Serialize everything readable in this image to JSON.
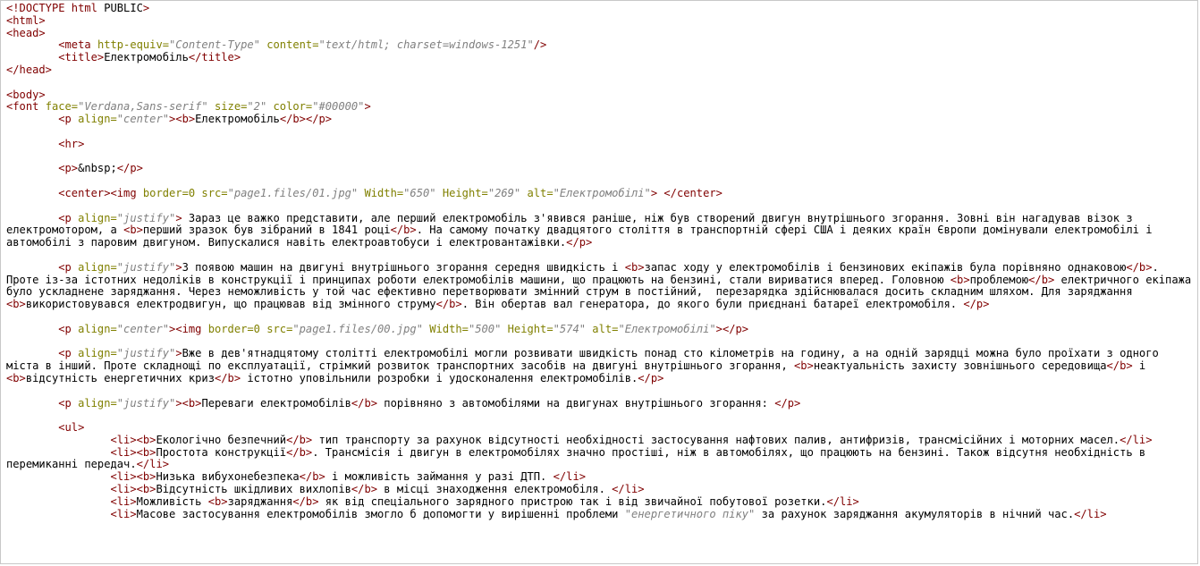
{
  "editor": {
    "colors": {
      "tag": "#800000",
      "attribute": "#808000",
      "string": "#808080",
      "text": "#000000",
      "border": "#c8c8c8"
    },
    "lines": [
      [
        [
          "tag",
          "<!DOCTYPE html"
        ],
        [
          "text",
          " PUBLIC"
        ],
        [
          "tag",
          ">"
        ]
      ],
      [
        [
          "tag",
          "<html>"
        ]
      ],
      [
        [
          "tag",
          "<head>"
        ]
      ],
      [
        [
          "text",
          "        "
        ],
        [
          "tag",
          "<meta "
        ],
        [
          "attr",
          "http-equiv="
        ],
        [
          "str",
          "\"Content-Type\""
        ],
        [
          "attr",
          " content="
        ],
        [
          "str",
          "\"text/html; charset=windows-1251\""
        ],
        [
          "tag",
          "/>"
        ]
      ],
      [
        [
          "text",
          "        "
        ],
        [
          "tag",
          "<title>"
        ],
        [
          "text",
          "Електромобіль"
        ],
        [
          "tag",
          "</title>"
        ]
      ],
      [
        [
          "tag",
          "</head>"
        ]
      ],
      [],
      [
        [
          "tag",
          "<body>"
        ]
      ],
      [
        [
          "tag",
          "<font "
        ],
        [
          "attr",
          "face="
        ],
        [
          "str",
          "\"Verdana,Sans-serif\""
        ],
        [
          "attr",
          " size="
        ],
        [
          "str",
          "\"2\""
        ],
        [
          "attr",
          " color="
        ],
        [
          "str",
          "\"#00000\""
        ],
        [
          "tag",
          ">"
        ]
      ],
      [
        [
          "text",
          "        "
        ],
        [
          "tag",
          "<p "
        ],
        [
          "attr",
          "align="
        ],
        [
          "str",
          "\"center\""
        ],
        [
          "tag",
          ">"
        ],
        [
          "tag",
          "<b>"
        ],
        [
          "text",
          "Електромобіль"
        ],
        [
          "tag",
          "</b>"
        ],
        [
          "tag",
          "</p>"
        ]
      ],
      [],
      [
        [
          "text",
          "        "
        ],
        [
          "tag",
          "<hr>"
        ]
      ],
      [],
      [
        [
          "text",
          "        "
        ],
        [
          "tag",
          "<p>"
        ],
        [
          "text",
          "&nbsp;"
        ],
        [
          "tag",
          "</p>"
        ]
      ],
      [],
      [
        [
          "text",
          "        "
        ],
        [
          "tag",
          "<center>"
        ],
        [
          "tag",
          "<img "
        ],
        [
          "attr",
          "border=0 src="
        ],
        [
          "str",
          "\"page1.files/01.jpg\""
        ],
        [
          "attr",
          " Width="
        ],
        [
          "str",
          "\"650\""
        ],
        [
          "attr",
          " Height="
        ],
        [
          "str",
          "\"269\""
        ],
        [
          "attr",
          " alt="
        ],
        [
          "str",
          "\"Електромобілі\""
        ],
        [
          "tag",
          ">"
        ],
        [
          "text",
          " "
        ],
        [
          "tag",
          "</center>"
        ]
      ],
      [],
      [
        [
          "text",
          "        "
        ],
        [
          "tag",
          "<p "
        ],
        [
          "attr",
          "align="
        ],
        [
          "str",
          "\"justify\""
        ],
        [
          "tag",
          ">"
        ],
        [
          "text",
          " Зараз це важко представити, але перший електромобіль з'явився раніше, ніж був створений двигун внутрішнього згорання. Зовні він нагадував візок з електромотором, а "
        ],
        [
          "tag",
          "<b>"
        ],
        [
          "text",
          "перший зразок був зібраний в 1841 році"
        ],
        [
          "tag",
          "</b>"
        ],
        [
          "text",
          ". На самому початку двадцятого століття в транспортній сфері США і деяких країн Європи домінували електромобілі і автомобілі з паровим двигуном. Випускалися навіть електроавтобуси і електровантажівки."
        ],
        [
          "tag",
          "</p>"
        ]
      ],
      [],
      [
        [
          "text",
          "        "
        ],
        [
          "tag",
          "<p "
        ],
        [
          "attr",
          "align="
        ],
        [
          "str",
          "\"justify\""
        ],
        [
          "tag",
          ">"
        ],
        [
          "text",
          "З появою машин на двигуні внутрішнього згорання середня швидкість і "
        ],
        [
          "tag",
          "<b>"
        ],
        [
          "text",
          "запас ходу у електромобілів і бензинових екіпажів була порівняно однаковою"
        ],
        [
          "tag",
          "</b>"
        ],
        [
          "text",
          ". Проте із-за істотних недоліків в конструкції і принципах роботи електромобілів машини, що працюють на бензині, стали вириватися вперед. Головною "
        ],
        [
          "tag",
          "<b>"
        ],
        [
          "text",
          "проблемою"
        ],
        [
          "tag",
          "</b>"
        ],
        [
          "text",
          " електричного екіпажа було ускладнене заряджання. Через неможливість у той час ефективно перетворювати змінний струм в постійний,  перезарядка здійснювалася досить складним шляхом. Для заряджання "
        ],
        [
          "tag",
          "<b>"
        ],
        [
          "text",
          "використовувався електродвигун, що працював від змінного струму"
        ],
        [
          "tag",
          "</b>"
        ],
        [
          "text",
          ". Він обертав вал генератора, до якого були приєднані батареї електромобіля. "
        ],
        [
          "tag",
          "</p>"
        ]
      ],
      [],
      [
        [
          "text",
          "        "
        ],
        [
          "tag",
          "<p "
        ],
        [
          "attr",
          "align="
        ],
        [
          "str",
          "\"center\""
        ],
        [
          "tag",
          ">"
        ],
        [
          "tag",
          "<img "
        ],
        [
          "attr",
          "border=0 src="
        ],
        [
          "str",
          "\"page1.files/00.jpg\""
        ],
        [
          "attr",
          " Width="
        ],
        [
          "str",
          "\"500\""
        ],
        [
          "attr",
          " Height="
        ],
        [
          "str",
          "\"574\""
        ],
        [
          "attr",
          " alt="
        ],
        [
          "str",
          "\"Електромобілі\""
        ],
        [
          "tag",
          ">"
        ],
        [
          "tag",
          "</p>"
        ]
      ],
      [],
      [
        [
          "text",
          "        "
        ],
        [
          "tag",
          "<p "
        ],
        [
          "attr",
          "align="
        ],
        [
          "str",
          "\"justify\""
        ],
        [
          "tag",
          ">"
        ],
        [
          "text",
          "Вже в дев'ятнадцятому столітті електромобілі могли розвивати швидкість понад сто кілометрів на годину, а на одній зарядці можна було проїхати з одного міста в інший. Проте складнощі по експлуатації, стрімкий розвиток транспортних засобів на двигуні внутрішнього згорання, "
        ],
        [
          "tag",
          "<b>"
        ],
        [
          "text",
          "неактуальність захисту зовнішнього середовища"
        ],
        [
          "tag",
          "</b>"
        ],
        [
          "text",
          " і "
        ],
        [
          "tag",
          "<b>"
        ],
        [
          "text",
          "відсутність енергетичних криз"
        ],
        [
          "tag",
          "</b>"
        ],
        [
          "text",
          " істотно уповільнили розробки і удосконалення електромобілів."
        ],
        [
          "tag",
          "</p>"
        ]
      ],
      [],
      [
        [
          "text",
          "        "
        ],
        [
          "tag",
          "<p "
        ],
        [
          "attr",
          "align="
        ],
        [
          "str",
          "\"justify\""
        ],
        [
          "tag",
          ">"
        ],
        [
          "tag",
          "<b>"
        ],
        [
          "text",
          "Переваги електромобілів"
        ],
        [
          "tag",
          "</b>"
        ],
        [
          "text",
          " порівняно з автомобілями на двигунах внутрішнього згорання: "
        ],
        [
          "tag",
          "</p>"
        ]
      ],
      [],
      [
        [
          "text",
          "        "
        ],
        [
          "tag",
          "<ul>"
        ]
      ],
      [
        [
          "text",
          "                "
        ],
        [
          "tag",
          "<li>"
        ],
        [
          "tag",
          "<b>"
        ],
        [
          "text",
          "Екологічно безпечний"
        ],
        [
          "tag",
          "</b>"
        ],
        [
          "text",
          " тип транспорту за рахунок відсутності необхідності застосування нафтових палив, антифризів, трансмісійних і моторних масел."
        ],
        [
          "tag",
          "</li>"
        ]
      ],
      [
        [
          "text",
          "                "
        ],
        [
          "tag",
          "<li>"
        ],
        [
          "tag",
          "<b>"
        ],
        [
          "text",
          "Простота конструкції"
        ],
        [
          "tag",
          "</b>"
        ],
        [
          "text",
          ". Трансмісія і двигун в електромобілях значно простіші, ніж в автомобілях, що працюють на бензині. Також відсутня необхідність в перемиканні передач."
        ],
        [
          "tag",
          "</li>"
        ]
      ],
      [
        [
          "text",
          "                "
        ],
        [
          "tag",
          "<li>"
        ],
        [
          "tag",
          "<b>"
        ],
        [
          "text",
          "Низька вибухонебезпека"
        ],
        [
          "tag",
          "</b>"
        ],
        [
          "text",
          " і можливість займання у разі ДТП. "
        ],
        [
          "tag",
          "</li>"
        ]
      ],
      [
        [
          "text",
          "                "
        ],
        [
          "tag",
          "<li>"
        ],
        [
          "tag",
          "<b>"
        ],
        [
          "text",
          "Відсутність шкідливих вихлопів"
        ],
        [
          "tag",
          "</b>"
        ],
        [
          "text",
          " в місці знаходження електромобіля. "
        ],
        [
          "tag",
          "</li>"
        ]
      ],
      [
        [
          "text",
          "                "
        ],
        [
          "tag",
          "<li>"
        ],
        [
          "text",
          "Можливість "
        ],
        [
          "tag",
          "<b>"
        ],
        [
          "text",
          "заряджання"
        ],
        [
          "tag",
          "</b>"
        ],
        [
          "text",
          " як від спеціального зарядного пристрою так і від звичайної побутової розетки."
        ],
        [
          "tag",
          "</li>"
        ]
      ],
      [
        [
          "text",
          "                "
        ],
        [
          "tag",
          "<li>"
        ],
        [
          "text",
          "Масове застосування електромобілів змогло б допомогти у вирішенні проблеми "
        ],
        [
          "str",
          "\"енергетичного піку\""
        ],
        [
          "text",
          " за рахунок заряджання акумуляторів в нічний час."
        ],
        [
          "tag",
          "</li>"
        ]
      ]
    ]
  }
}
